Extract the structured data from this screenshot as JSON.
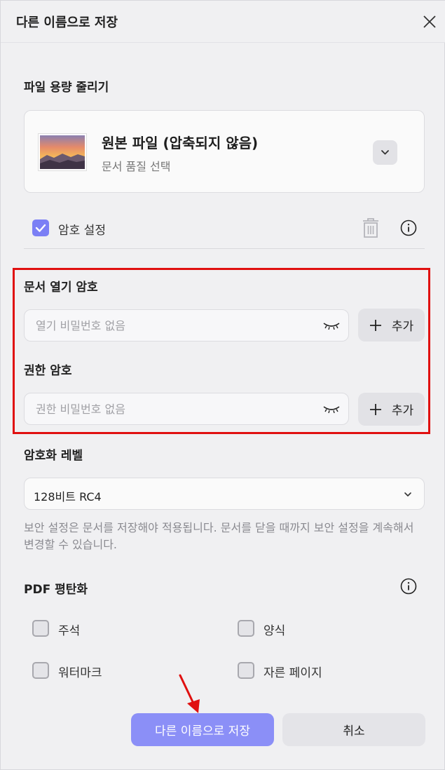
{
  "dialog": {
    "title": "다른 이름으로 저장"
  },
  "compress": {
    "section_label": "파일 용량 줄리기",
    "quality_title": "원본 파일 (압축되지 않음)",
    "quality_subtitle": "문서 품질 선택"
  },
  "password": {
    "checkbox_label": "암호 설정",
    "checked": true,
    "open_label": "문서 열기 암호",
    "open_placeholder": "열기 비밀번호 없음",
    "permission_label": "권한 암호",
    "permission_placeholder": "권한 비밀번호 없음",
    "add_label": "추가"
  },
  "encryption": {
    "label": "암호화 레벨",
    "selected": "128비트 RC4",
    "help": "보안 설정은 문서를 저장해야 적용됩니다. 문서를 닫을 때까지 보안 설정을 계속해서 변경할 수 있습니다."
  },
  "flatten": {
    "label": "PDF 평탄화",
    "items": [
      {
        "label": "주석",
        "checked": false
      },
      {
        "label": "양식",
        "checked": false
      },
      {
        "label": "워터마크",
        "checked": false
      },
      {
        "label": "자른 페이지",
        "checked": false
      }
    ]
  },
  "footer": {
    "save_label": "다른 이름으로 저장",
    "cancel_label": "취소"
  },
  "colors": {
    "accent": "#8b8ff7",
    "checkbox": "#7b7ff5",
    "highlight": "#e01010"
  }
}
